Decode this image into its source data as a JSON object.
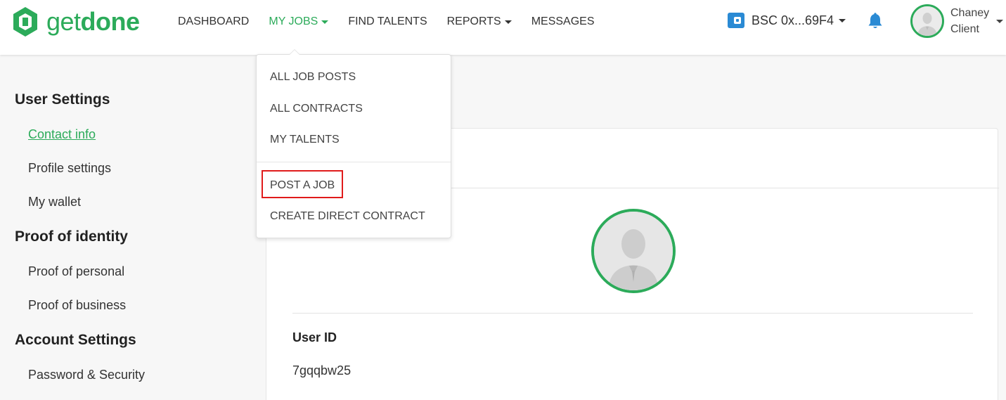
{
  "brand": {
    "logo_get": "get",
    "logo_done": "done",
    "color": "#2cab5a"
  },
  "nav": {
    "items": [
      {
        "label": "DASHBOARD",
        "dropdown": false,
        "active": false
      },
      {
        "label": "MY JOBS",
        "dropdown": true,
        "active": true
      },
      {
        "label": "FIND TALENTS",
        "dropdown": false,
        "active": false
      },
      {
        "label": "REPORTS",
        "dropdown": true,
        "active": false
      },
      {
        "label": "MESSAGES",
        "dropdown": false,
        "active": false
      }
    ]
  },
  "wallet": {
    "label": "BSC 0x...69F4",
    "icon": "wallet-icon"
  },
  "notifications": {
    "icon": "bell-icon"
  },
  "user": {
    "name": "Chaney",
    "role": "Client"
  },
  "sidebar": {
    "user_settings": "User Settings",
    "contact_info": "Contact info",
    "profile_settings": "Profile settings",
    "my_wallet": "My wallet",
    "proof_of_identity": "Proof of identity",
    "proof_personal": "Proof of personal",
    "proof_business": "Proof of business",
    "account_settings": "Account Settings",
    "password_security": "Password & Security"
  },
  "profile": {
    "user_id_label": "User ID",
    "user_id_value": "7gqqbw25"
  },
  "dropdown": {
    "all_job_posts": "ALL JOB POSTS",
    "all_contracts": "ALL CONTRACTS",
    "my_talents": "MY TALENTS",
    "post_a_job": "POST A JOB",
    "create_direct_contract": "CREATE DIRECT CONTRACT"
  },
  "colors": {
    "accent": "#2cab5a",
    "highlight": "#e01b1b",
    "wallet": "#2a8ad4",
    "bell": "#2a8ad4"
  }
}
